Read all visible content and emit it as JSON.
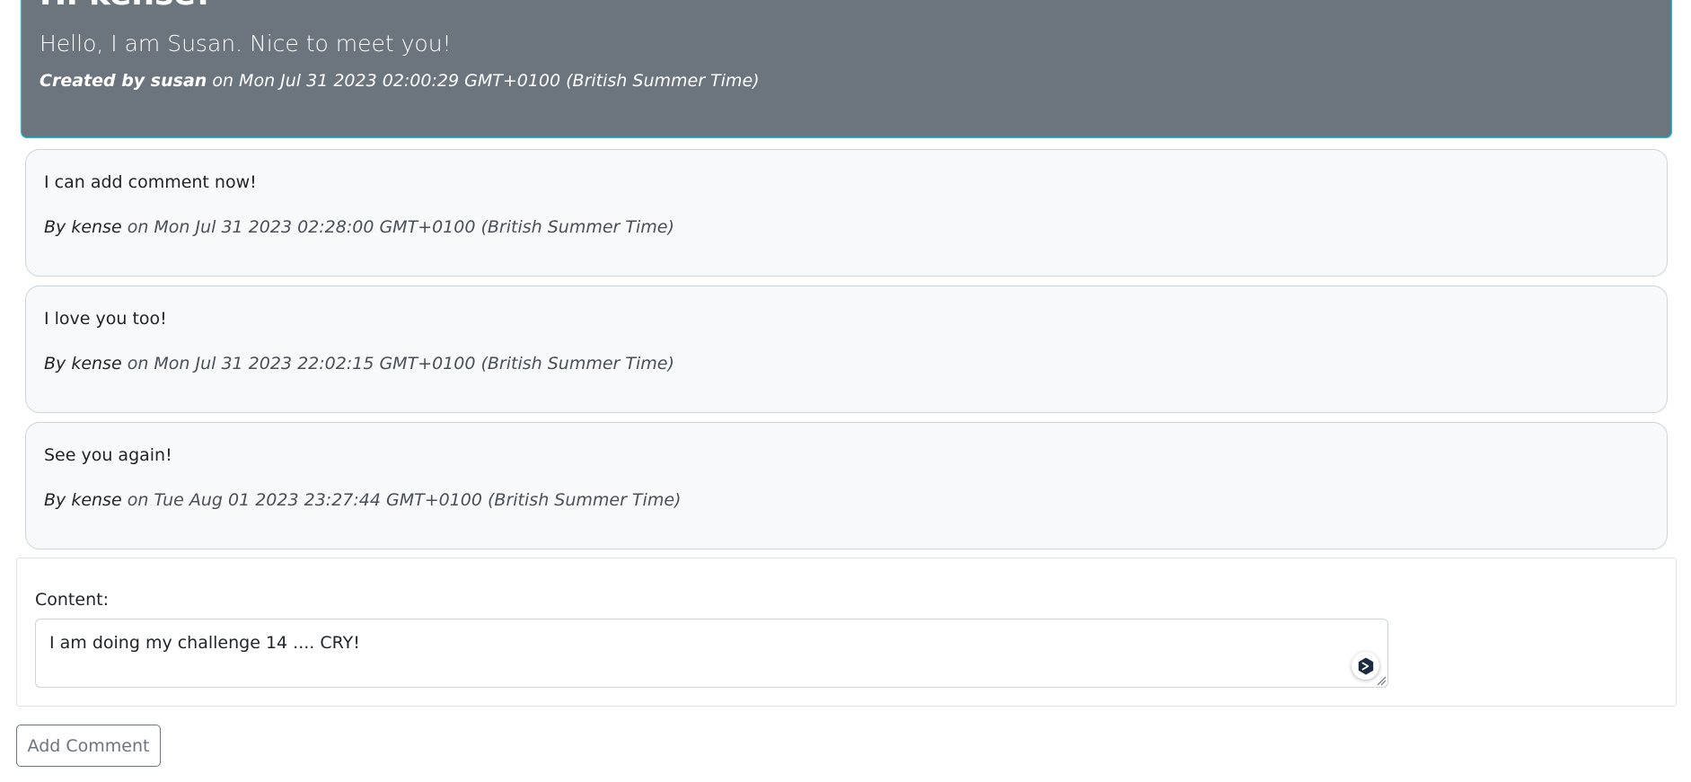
{
  "post": {
    "title": "Hi kense!",
    "body": "Hello, I am Susan. Nice to meet you!",
    "meta_created_by": "Created by susan",
    "meta_date": " on Mon Jul 31 2023 02:00:29 GMT+0100 (British Summer Time)"
  },
  "comments": [
    {
      "text": "I can add comment now!",
      "author_label": "By kense",
      "date": " on Mon Jul 31 2023 02:28:00 GMT+0100 (British Summer Time)"
    },
    {
      "text": "I love you too!",
      "author_label": "By kense",
      "date": " on Mon Jul 31 2023 22:02:15 GMT+0100 (British Summer Time)"
    },
    {
      "text": "See you again!",
      "author_label": "By kense",
      "date": " on Tue Aug 01 2023 23:27:44 GMT+0100 (British Summer Time)"
    }
  ],
  "form": {
    "label": "Content:",
    "value": "I am doing my challenge 14 .... CRY!",
    "submit_label": "Add Comment"
  },
  "icons": {
    "assistant": "assistant-extension-icon",
    "resize": "resize-grip-icon"
  },
  "colors": {
    "post_bg": "#6c757d",
    "post_border": "#0dcaf0",
    "comment_bg": "#f8f9fa",
    "button_outline": "#6c757d"
  }
}
